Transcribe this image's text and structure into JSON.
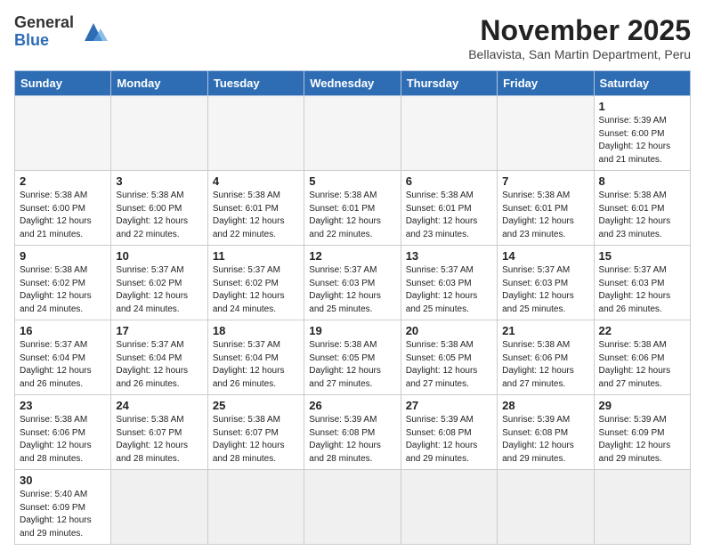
{
  "header": {
    "logo_general": "General",
    "logo_blue": "Blue",
    "month_title": "November 2025",
    "location": "Bellavista, San Martin Department, Peru"
  },
  "weekdays": [
    "Sunday",
    "Monday",
    "Tuesday",
    "Wednesday",
    "Thursday",
    "Friday",
    "Saturday"
  ],
  "weeks": [
    [
      {
        "day": "",
        "info": ""
      },
      {
        "day": "",
        "info": ""
      },
      {
        "day": "",
        "info": ""
      },
      {
        "day": "",
        "info": ""
      },
      {
        "day": "",
        "info": ""
      },
      {
        "day": "",
        "info": ""
      },
      {
        "day": "1",
        "info": "Sunrise: 5:39 AM\nSunset: 6:00 PM\nDaylight: 12 hours\nand 21 minutes."
      }
    ],
    [
      {
        "day": "2",
        "info": "Sunrise: 5:38 AM\nSunset: 6:00 PM\nDaylight: 12 hours\nand 21 minutes."
      },
      {
        "day": "3",
        "info": "Sunrise: 5:38 AM\nSunset: 6:00 PM\nDaylight: 12 hours\nand 22 minutes."
      },
      {
        "day": "4",
        "info": "Sunrise: 5:38 AM\nSunset: 6:01 PM\nDaylight: 12 hours\nand 22 minutes."
      },
      {
        "day": "5",
        "info": "Sunrise: 5:38 AM\nSunset: 6:01 PM\nDaylight: 12 hours\nand 22 minutes."
      },
      {
        "day": "6",
        "info": "Sunrise: 5:38 AM\nSunset: 6:01 PM\nDaylight: 12 hours\nand 23 minutes."
      },
      {
        "day": "7",
        "info": "Sunrise: 5:38 AM\nSunset: 6:01 PM\nDaylight: 12 hours\nand 23 minutes."
      },
      {
        "day": "8",
        "info": "Sunrise: 5:38 AM\nSunset: 6:01 PM\nDaylight: 12 hours\nand 23 minutes."
      }
    ],
    [
      {
        "day": "9",
        "info": "Sunrise: 5:38 AM\nSunset: 6:02 PM\nDaylight: 12 hours\nand 24 minutes."
      },
      {
        "day": "10",
        "info": "Sunrise: 5:37 AM\nSunset: 6:02 PM\nDaylight: 12 hours\nand 24 minutes."
      },
      {
        "day": "11",
        "info": "Sunrise: 5:37 AM\nSunset: 6:02 PM\nDaylight: 12 hours\nand 24 minutes."
      },
      {
        "day": "12",
        "info": "Sunrise: 5:37 AM\nSunset: 6:03 PM\nDaylight: 12 hours\nand 25 minutes."
      },
      {
        "day": "13",
        "info": "Sunrise: 5:37 AM\nSunset: 6:03 PM\nDaylight: 12 hours\nand 25 minutes."
      },
      {
        "day": "14",
        "info": "Sunrise: 5:37 AM\nSunset: 6:03 PM\nDaylight: 12 hours\nand 25 minutes."
      },
      {
        "day": "15",
        "info": "Sunrise: 5:37 AM\nSunset: 6:03 PM\nDaylight: 12 hours\nand 26 minutes."
      }
    ],
    [
      {
        "day": "16",
        "info": "Sunrise: 5:37 AM\nSunset: 6:04 PM\nDaylight: 12 hours\nand 26 minutes."
      },
      {
        "day": "17",
        "info": "Sunrise: 5:37 AM\nSunset: 6:04 PM\nDaylight: 12 hours\nand 26 minutes."
      },
      {
        "day": "18",
        "info": "Sunrise: 5:37 AM\nSunset: 6:04 PM\nDaylight: 12 hours\nand 26 minutes."
      },
      {
        "day": "19",
        "info": "Sunrise: 5:38 AM\nSunset: 6:05 PM\nDaylight: 12 hours\nand 27 minutes."
      },
      {
        "day": "20",
        "info": "Sunrise: 5:38 AM\nSunset: 6:05 PM\nDaylight: 12 hours\nand 27 minutes."
      },
      {
        "day": "21",
        "info": "Sunrise: 5:38 AM\nSunset: 6:06 PM\nDaylight: 12 hours\nand 27 minutes."
      },
      {
        "day": "22",
        "info": "Sunrise: 5:38 AM\nSunset: 6:06 PM\nDaylight: 12 hours\nand 27 minutes."
      }
    ],
    [
      {
        "day": "23",
        "info": "Sunrise: 5:38 AM\nSunset: 6:06 PM\nDaylight: 12 hours\nand 28 minutes."
      },
      {
        "day": "24",
        "info": "Sunrise: 5:38 AM\nSunset: 6:07 PM\nDaylight: 12 hours\nand 28 minutes."
      },
      {
        "day": "25",
        "info": "Sunrise: 5:38 AM\nSunset: 6:07 PM\nDaylight: 12 hours\nand 28 minutes."
      },
      {
        "day": "26",
        "info": "Sunrise: 5:39 AM\nSunset: 6:08 PM\nDaylight: 12 hours\nand 28 minutes."
      },
      {
        "day": "27",
        "info": "Sunrise: 5:39 AM\nSunset: 6:08 PM\nDaylight: 12 hours\nand 29 minutes."
      },
      {
        "day": "28",
        "info": "Sunrise: 5:39 AM\nSunset: 6:08 PM\nDaylight: 12 hours\nand 29 minutes."
      },
      {
        "day": "29",
        "info": "Sunrise: 5:39 AM\nSunset: 6:09 PM\nDaylight: 12 hours\nand 29 minutes."
      }
    ],
    [
      {
        "day": "30",
        "info": "Sunrise: 5:40 AM\nSunset: 6:09 PM\nDaylight: 12 hours\nand 29 minutes."
      },
      {
        "day": "",
        "info": ""
      },
      {
        "day": "",
        "info": ""
      },
      {
        "day": "",
        "info": ""
      },
      {
        "day": "",
        "info": ""
      },
      {
        "day": "",
        "info": ""
      },
      {
        "day": "",
        "info": ""
      }
    ]
  ]
}
